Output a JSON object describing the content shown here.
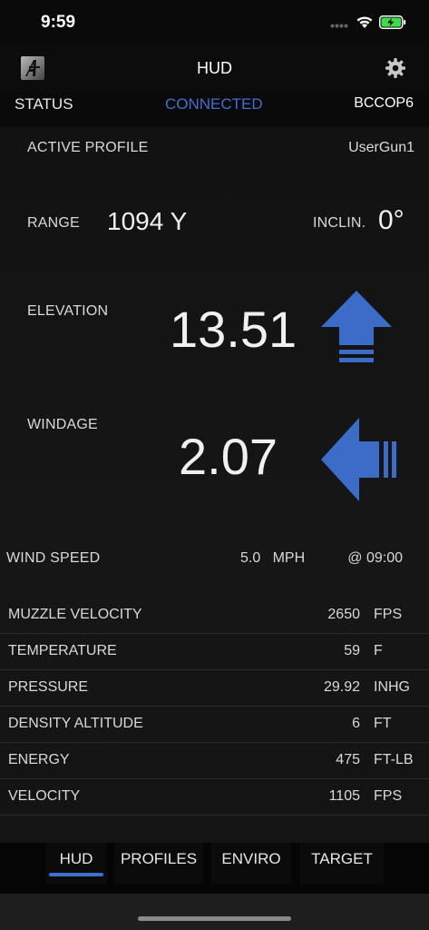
{
  "status_bar": {
    "time": "9:59"
  },
  "nav": {
    "title": "HUD"
  },
  "connection": {
    "label": "STATUS",
    "state": "CONNECTED",
    "device": "BCCOP6"
  },
  "profile": {
    "label": "ACTIVE PROFILE",
    "value": "UserGun1"
  },
  "range": {
    "label": "RANGE",
    "value": "1094 Y"
  },
  "inclination": {
    "label": "INCLIN.",
    "value": "0°"
  },
  "elevation": {
    "label": "ELEVATION",
    "value": "13.51",
    "direction": "up-arrow-icon"
  },
  "windage": {
    "label": "WINDAGE",
    "value": "2.07",
    "direction": "left-arrow-icon"
  },
  "wind": {
    "label": "WIND SPEED",
    "speed": "5.0   MPH",
    "direction": "@ 09:00"
  },
  "table": [
    {
      "label": "MUZZLE VELOCITY",
      "value": "2650",
      "unit": "FPS"
    },
    {
      "label": "TEMPERATURE",
      "value": "59",
      "unit": "F"
    },
    {
      "label": "PRESSURE",
      "value": "29.92",
      "unit": "INHG"
    },
    {
      "label": "DENSITY ALTITUDE",
      "value": "6",
      "unit": "FT"
    },
    {
      "label": "ENERGY",
      "value": "475",
      "unit": "FT-LB"
    },
    {
      "label": "VELOCITY",
      "value": "1105",
      "unit": "FPS"
    }
  ],
  "tabs": [
    {
      "label": "HUD",
      "active": true
    },
    {
      "label": "PROFILES",
      "active": false
    },
    {
      "label": "ENVIRO",
      "active": false
    },
    {
      "label": "TARGET",
      "active": false
    }
  ],
  "colors": {
    "accent": "#3f6fd1",
    "arrow": "#3a6cc8",
    "battery": "#3ddc4a"
  }
}
